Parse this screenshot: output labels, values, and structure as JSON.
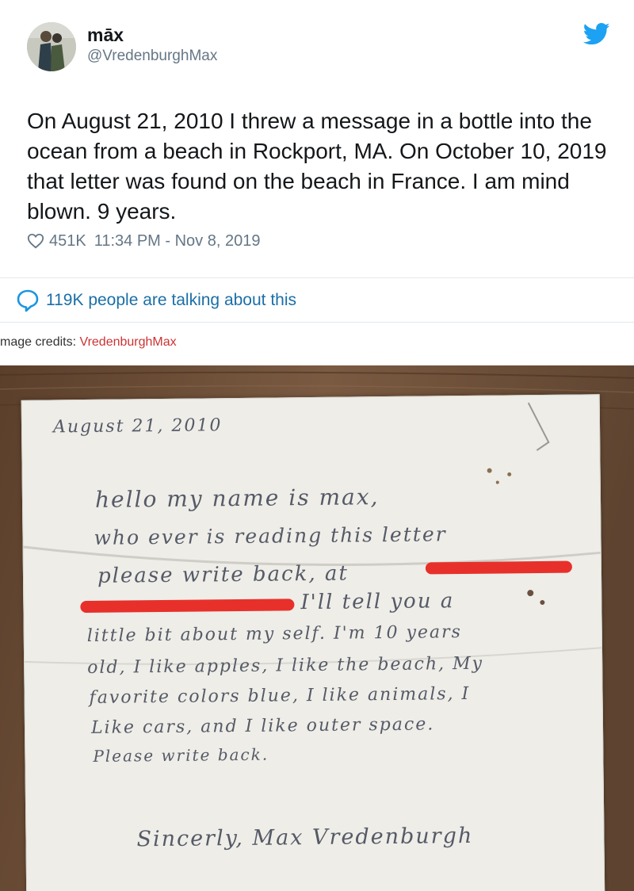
{
  "tweet": {
    "display_name": "māx",
    "handle": "@VredenburghMax",
    "text": "On August 21, 2010 I threw a message in a bottle into the ocean from a beach in Rockport, MA. On October 10, 2019 that letter was found on the beach in France. I am mind blown. 9 years.",
    "likes": "451K",
    "timestamp": "11:34 PM - Nov 8, 2019",
    "talking": "119K people are talking about this",
    "icons": {
      "like": "heart-icon",
      "talk": "speech-bubble-icon",
      "brand": "twitter-bird-icon"
    },
    "colors": {
      "twitter_blue": "#1da1f2",
      "link_blue": "#1b6fa7",
      "muted": "#657786"
    }
  },
  "credits": {
    "prefix": "mage credits: ",
    "author": "VredenburghMax"
  },
  "letter": {
    "date": "August 21, 2010",
    "lines": [
      "hello my   name   is      max,",
      "who ever is reading this letter",
      "please write back, at",
      "I'll tell you a",
      "little bit  about my self. I'm 10 years",
      "old, I like apples, I like the beach, My",
      "favorite colors blue, I like animals, I",
      "Like cars, and  I like outer space.",
      "Please write back."
    ],
    "signature": "Sincerly, Max Vredenburgh"
  }
}
